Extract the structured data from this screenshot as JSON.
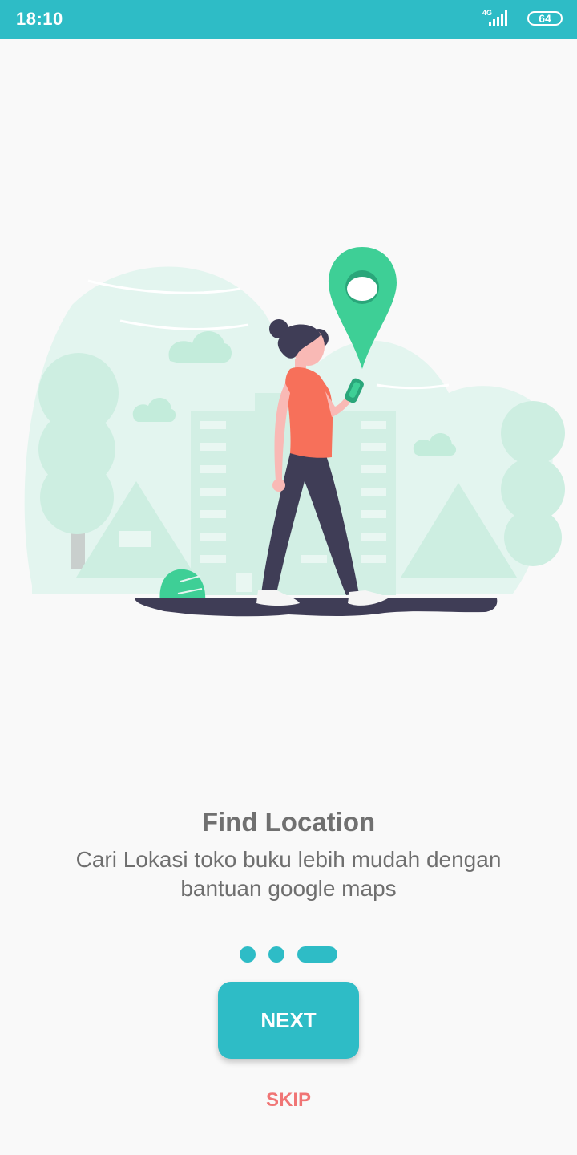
{
  "status_bar": {
    "time": "18:10",
    "network": "4G",
    "battery": "64",
    "icons": [
      "signal-icon",
      "battery-icon"
    ]
  },
  "illustration": {
    "icon": "location-pin-icon",
    "colors": {
      "accent": "#3ecf96",
      "background": "#e3f5ef",
      "figure_shirt": "#f7705a",
      "figure_pants": "#3f3d56"
    }
  },
  "onboarding": {
    "title": "Find Location",
    "description": "Cari Lokasi toko buku lebih mudah dengan bantuan google maps",
    "page_indicator": {
      "total": 3,
      "current": 3
    }
  },
  "actions": {
    "next_label": "NEXT",
    "skip_label": "SKIP"
  },
  "colors": {
    "primary": "#2ebcc6",
    "skip": "#f07575",
    "text": "#707070"
  }
}
